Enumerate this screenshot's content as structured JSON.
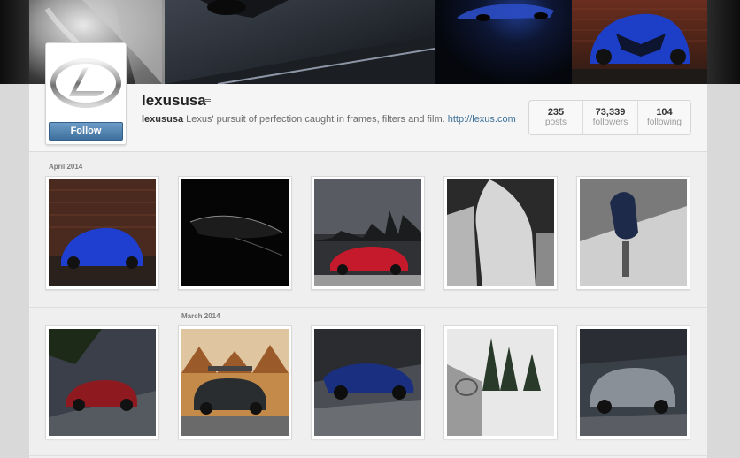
{
  "profile": {
    "username": "lexususa",
    "follow_label": "Follow",
    "bio_name": "lexususa",
    "bio_text": " Lexus' pursuit of perfection caught in frames, filters and film. ",
    "bio_link": "http://lexus.com",
    "stats": [
      {
        "value": "235",
        "label": "posts"
      },
      {
        "value": "73,339",
        "label": "followers"
      },
      {
        "value": "104",
        "label": "following"
      }
    ]
  },
  "sections": [
    {
      "month": "April 2014"
    },
    {
      "month": "March 2014"
    }
  ],
  "colors": {
    "follow_button": "#4f7fac",
    "link": "#3f729b",
    "panel_bg": "#efefef"
  }
}
